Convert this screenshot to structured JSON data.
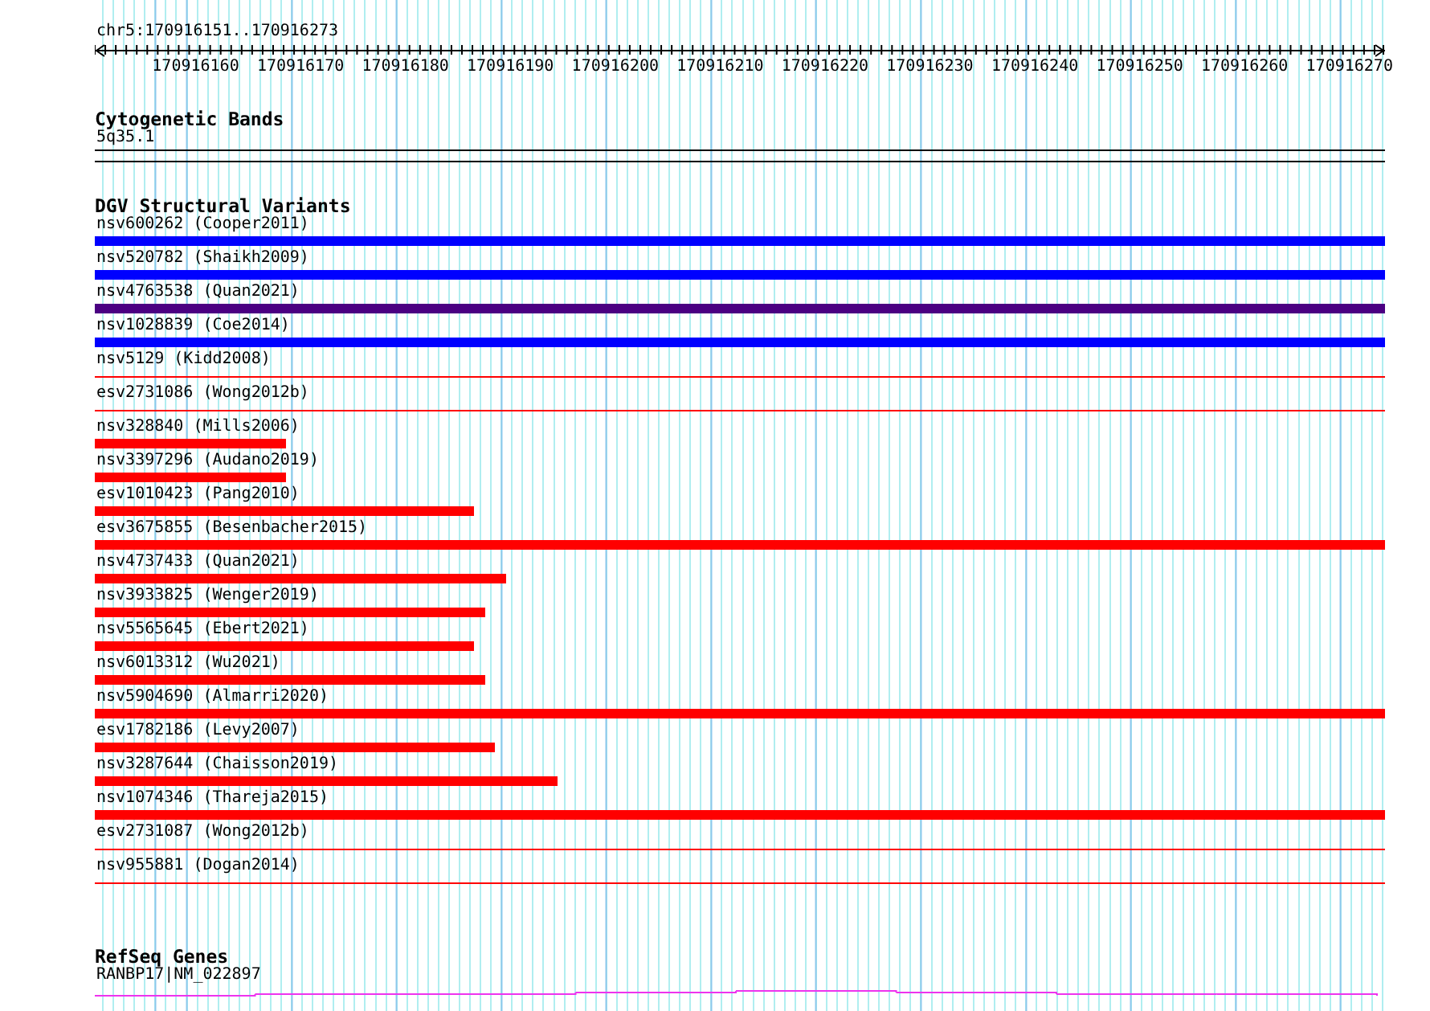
{
  "ruler": {
    "location": "chr5:170916151..170916273",
    "ticks": [
      "170916160",
      "170916170",
      "170916180",
      "170916190",
      "170916200",
      "170916210",
      "170916220",
      "170916230",
      "170916240",
      "170916250",
      "170916260",
      "170916270"
    ]
  },
  "cytogenetic_bands": {
    "title": "Cytogenetic Bands",
    "label": "5q35.1"
  },
  "dgv_structural_variants": {
    "title": "DGV Structural Variants",
    "features": [
      {
        "label": "nsv600262 (Cooper2011)",
        "kind": "bar",
        "color": "#0000ff",
        "level": 1
      },
      {
        "label": "nsv520782 (Shaikh2009)",
        "kind": "bar",
        "color": "#0000ff",
        "level": 1
      },
      {
        "label": "nsv4763538 (Quan2021)",
        "kind": "bar",
        "color": "#4b0082",
        "level": 1
      },
      {
        "label": "nsv1028839 (Coe2014)",
        "kind": "bar",
        "color": "#0000ff",
        "level": 1
      },
      {
        "label": "nsv5129 (Kidd2008)",
        "kind": "line",
        "color": "#ff0000",
        "level": 1
      },
      {
        "label": "esv2731086 (Wong2012b)",
        "kind": "line",
        "color": "#ff0000",
        "level": 1
      },
      {
        "label": "nsv328840 (Mills2006)",
        "kind": "bar",
        "color": "#ff0000",
        "level": 0.148
      },
      {
        "label": "nsv3397296 (Audano2019)",
        "kind": "bar",
        "color": "#ff0000",
        "level": 0.148
      },
      {
        "label": "esv1010423 (Pang2010)",
        "kind": "bar",
        "color": "#ff0000",
        "level": 0.294
      },
      {
        "label": "esv3675855 (Besenbacher2015)",
        "kind": "bar",
        "color": "#ff0000",
        "level": 1
      },
      {
        "label": "nsv4737433 (Quan2021)",
        "kind": "bar",
        "color": "#ff0000",
        "level": 0.319
      },
      {
        "label": "nsv3933825 (Wenger2019)",
        "kind": "bar",
        "color": "#ff0000",
        "level": 0.303
      },
      {
        "label": "nsv5565645 (Ebert2021)",
        "kind": "bar",
        "color": "#ff0000",
        "level": 0.294
      },
      {
        "label": "nsv6013312 (Wu2021)",
        "kind": "bar",
        "color": "#ff0000",
        "level": 0.303
      },
      {
        "label": "nsv5904690 (Almarri2020)",
        "kind": "bar",
        "color": "#ff0000",
        "level": 1
      },
      {
        "label": "esv1782186 (Levy2007)",
        "kind": "bar",
        "color": "#ff0000",
        "level": 0.31
      },
      {
        "label": "nsv3287644 (Chaisson2019)",
        "kind": "bar",
        "color": "#ff0000",
        "level": 0.359
      },
      {
        "label": "nsv1074346 (Thareja2015)",
        "kind": "bar",
        "color": "#ff0000",
        "level": 1
      },
      {
        "label": "esv2731087 (Wong2012b)",
        "kind": "line",
        "color": "#ff0000",
        "level": 1
      },
      {
        "label": "nsv955881 (Dogan2014)",
        "kind": "line",
        "color": "#ff0000",
        "level": 1
      }
    ]
  },
  "refseq_genes": {
    "title": "RefSeq Genes",
    "label": "RANBP17|NM_022897"
  }
}
